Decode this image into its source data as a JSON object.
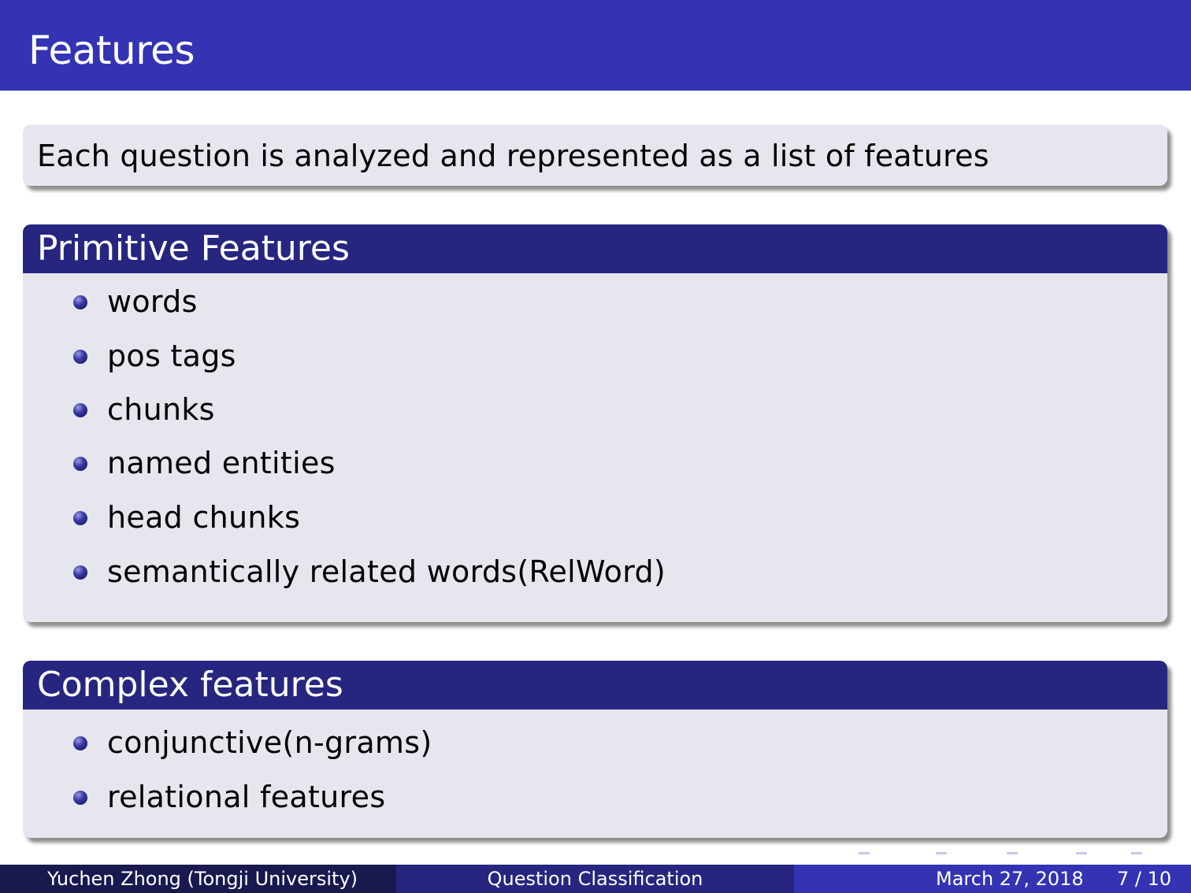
{
  "frame": {
    "title": "Features"
  },
  "intro_block": {
    "text": "Each question is analyzed and represented as a list of features"
  },
  "primitive_block": {
    "title": "Primitive Features",
    "items": [
      "words",
      "pos tags",
      "chunks",
      "named entities",
      "head chunks",
      "semantically related words(RelWord)"
    ]
  },
  "complex_block": {
    "title": "Complex features",
    "items": [
      "conjunctive(n-grams)",
      "relational features"
    ]
  },
  "footer": {
    "author": "Yuchen Zhong  (Tongji University)",
    "title": "Question Classification",
    "date": "March 27, 2018",
    "page": "7 / 10"
  },
  "colors": {
    "title_bar": "#3333b3",
    "block_title": "#262680",
    "block_body": "#e6e6ef",
    "footer_left": "#191950",
    "footer_mid": "#262680",
    "footer_right": "#3333b3"
  }
}
